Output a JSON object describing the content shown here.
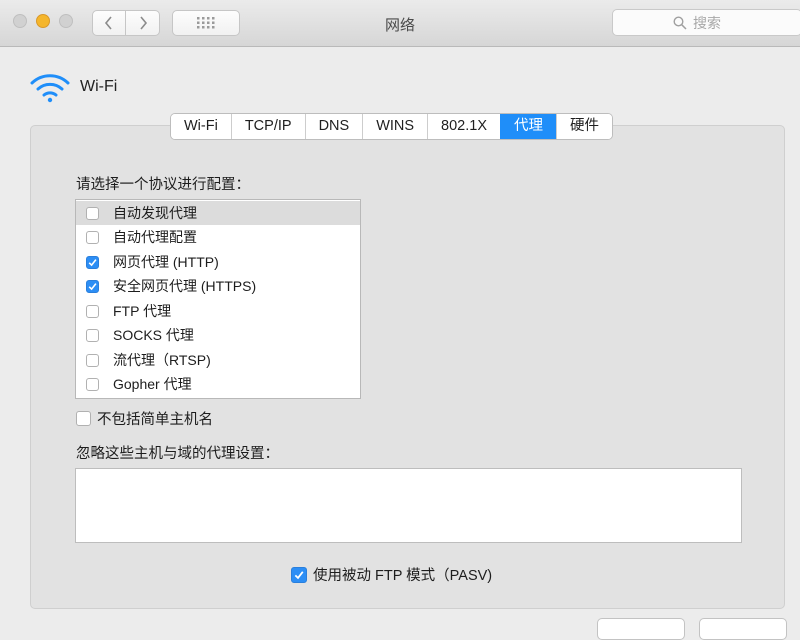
{
  "window": {
    "title": "网络",
    "search_placeholder": "搜索"
  },
  "header": {
    "interface_name": "Wi-Fi"
  },
  "tabs": [
    {
      "label": "Wi-Fi"
    },
    {
      "label": "TCP/IP"
    },
    {
      "label": "DNS"
    },
    {
      "label": "WINS"
    },
    {
      "label": "802.1X"
    },
    {
      "label": "代理",
      "active": true
    },
    {
      "label": "硬件"
    }
  ],
  "proxy": {
    "select_label": "请选择一个协议进行配置：",
    "protocols": [
      {
        "label": "自动发现代理",
        "checked": false,
        "selected": true
      },
      {
        "label": "自动代理配置",
        "checked": false
      },
      {
        "label": "网页代理 (HTTP)",
        "checked": true
      },
      {
        "label": "安全网页代理 (HTTPS)",
        "checked": true
      },
      {
        "label": "FTP 代理",
        "checked": false
      },
      {
        "label": "SOCKS 代理",
        "checked": false
      },
      {
        "label": "流代理（RTSP)",
        "checked": false
      },
      {
        "label": "Gopher 代理",
        "checked": false
      }
    ],
    "exclude_simple": {
      "label": "不包括简单主机名",
      "checked": false
    },
    "bypass_label": "忽略这些主机与域的代理设置：",
    "bypass_value": "",
    "passive_ftp": {
      "label": "使用被动 FTP 模式（PASV)",
      "checked": true
    }
  },
  "colors": {
    "accent": "#1f8ef9",
    "minimize": "#f5b62c"
  }
}
